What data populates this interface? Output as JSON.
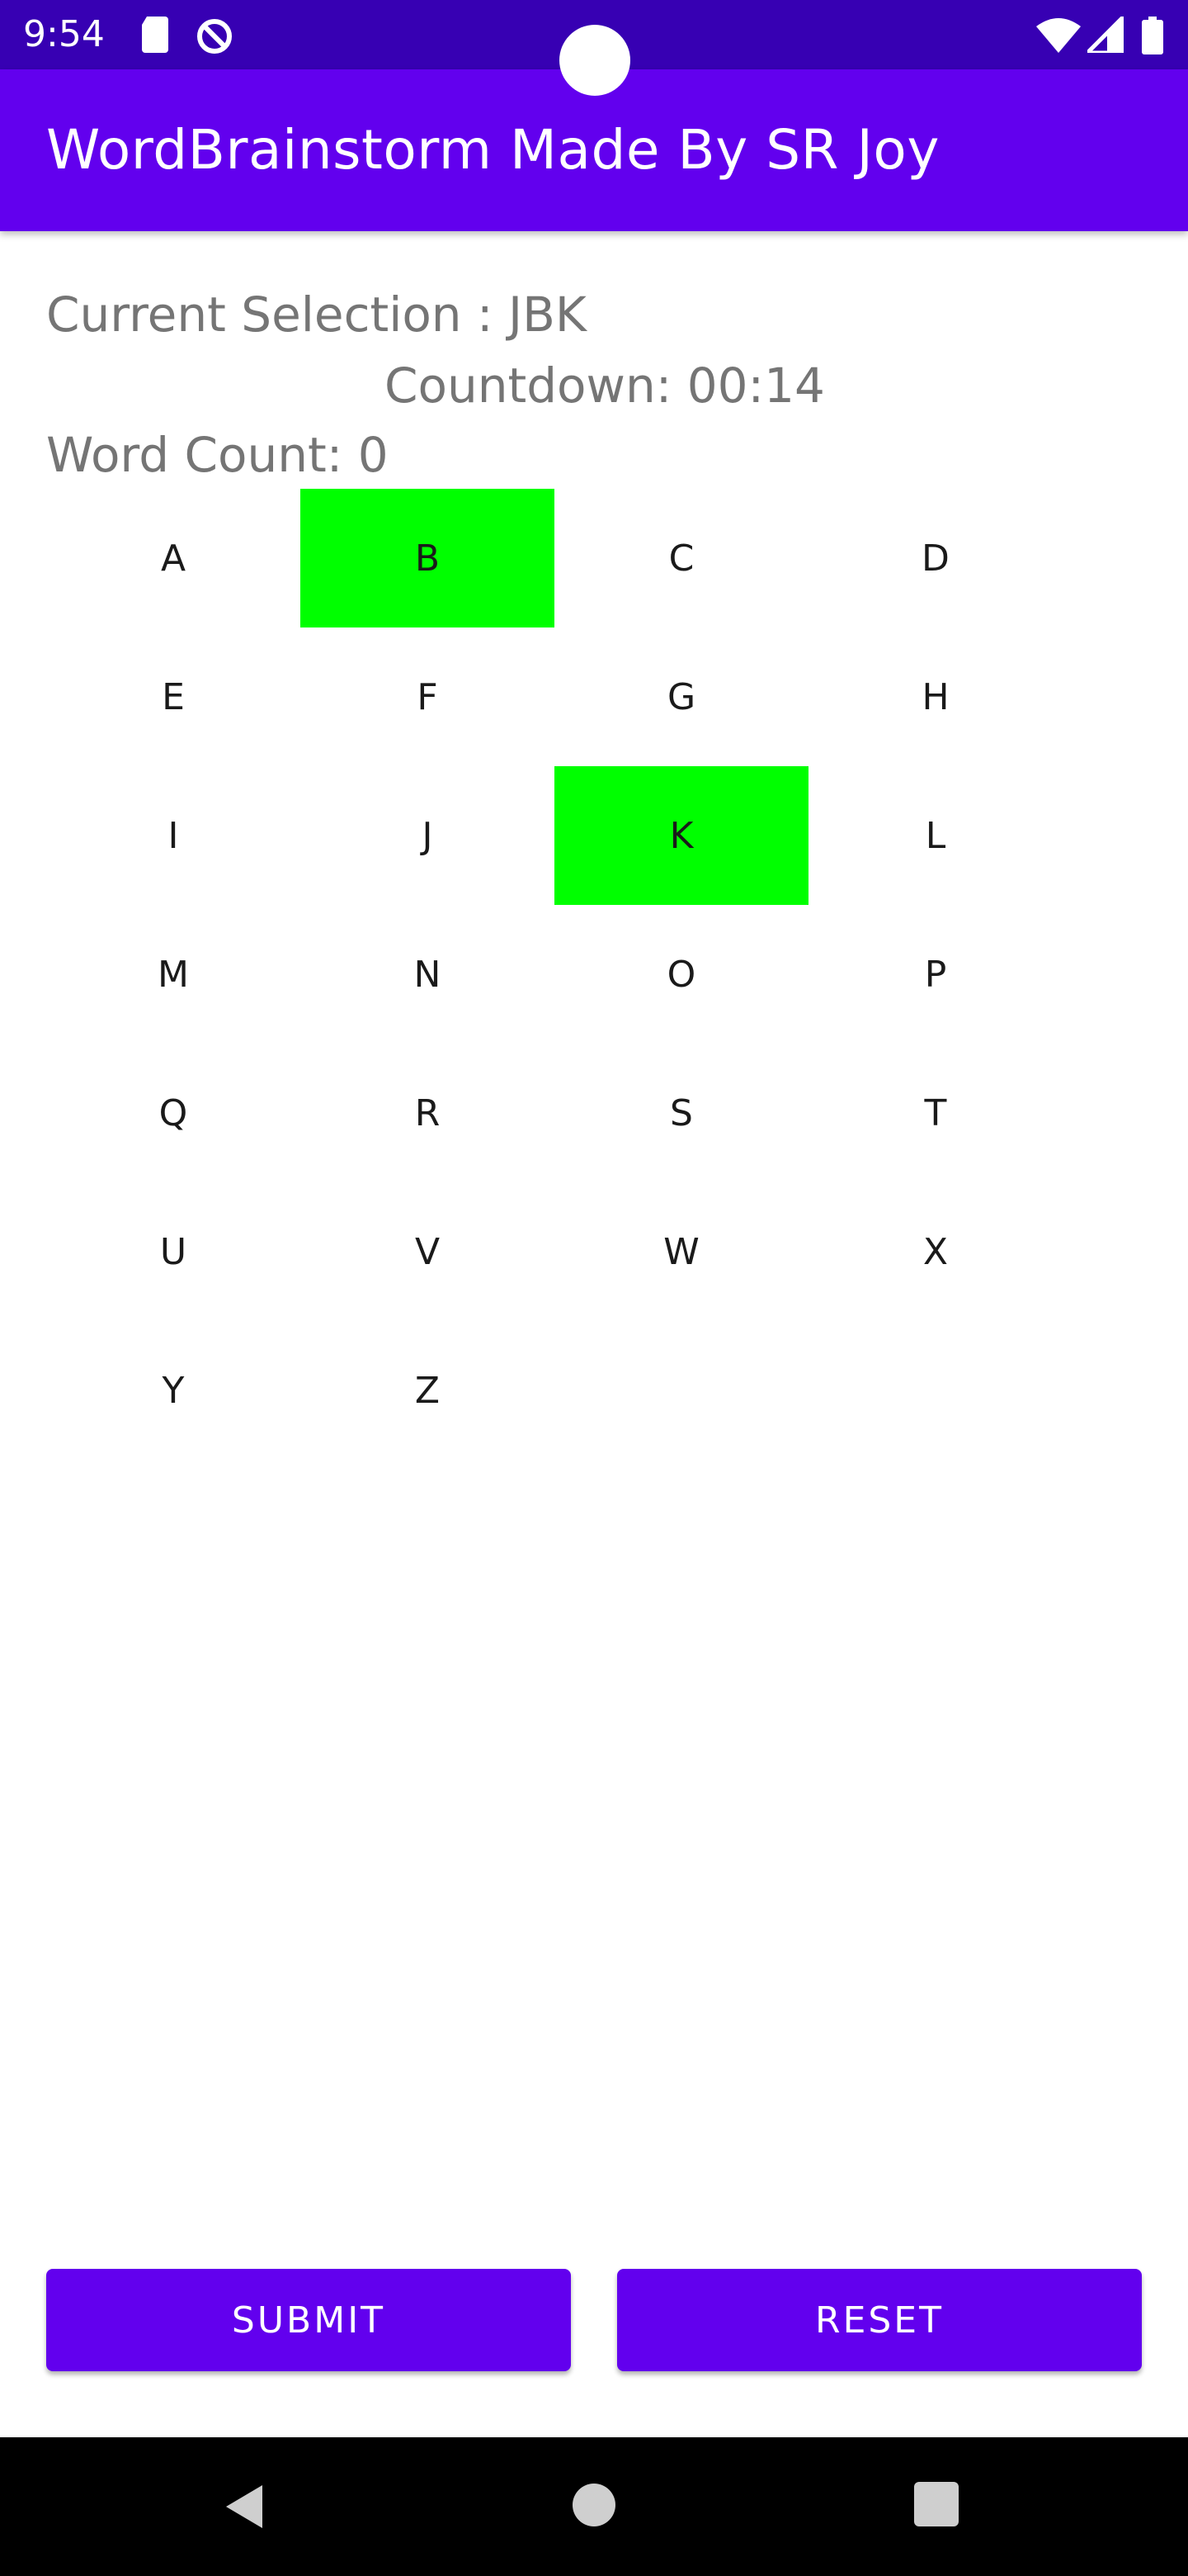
{
  "status_bar": {
    "time": "9:54",
    "left_icons": [
      "sd-card-icon",
      "do-not-disturb-icon"
    ],
    "right_icons": [
      "wifi-icon",
      "cell-signal-icon",
      "battery-icon"
    ]
  },
  "app_bar": {
    "title": "WordBrainstorm Made By SR Joy"
  },
  "game": {
    "current_selection": "Current Selection : JBK",
    "countdown": "Countdown: 00:14",
    "word_count": "Word Count: 0",
    "letters": [
      "A",
      "B",
      "C",
      "D",
      "E",
      "F",
      "G",
      "H",
      "I",
      "J",
      "K",
      "L",
      "M",
      "N",
      "O",
      "P",
      "Q",
      "R",
      "S",
      "T",
      "U",
      "V",
      "W",
      "X",
      "Y",
      "Z"
    ],
    "highlighted": [
      "B",
      "K"
    ],
    "highlight_color": "#00ff00"
  },
  "buttons": {
    "submit": "SUBMIT",
    "reset": "RESET"
  },
  "colors": {
    "primary": "#6200ee",
    "primary_dark": "#3700b3",
    "secondary_text": "#757575"
  },
  "nav_bar": {
    "icons": [
      "back-icon",
      "home-icon",
      "recents-icon"
    ]
  }
}
